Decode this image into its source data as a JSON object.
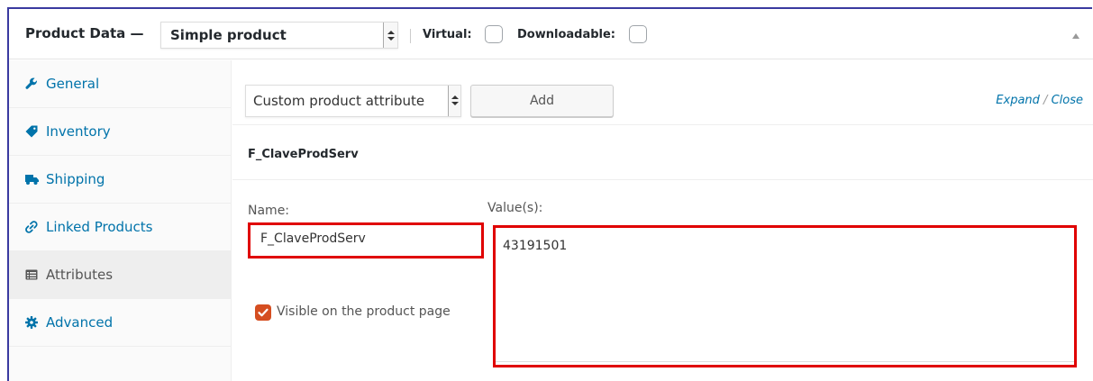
{
  "header": {
    "title": "Product Data —",
    "product_type": "Simple product",
    "virtual_label": "Virtual:",
    "downloadable_label": "Downloadable:"
  },
  "sidebar": {
    "items": [
      {
        "label": "General",
        "icon": "wrench-icon"
      },
      {
        "label": "Inventory",
        "icon": "tag-icon"
      },
      {
        "label": "Shipping",
        "icon": "truck-icon"
      },
      {
        "label": "Linked Products",
        "icon": "link-icon"
      },
      {
        "label": "Attributes",
        "icon": "list-icon",
        "active": true
      },
      {
        "label": "Advanced",
        "icon": "gear-icon"
      }
    ]
  },
  "toolbar": {
    "attribute_select": "Custom product attribute",
    "add_label": "Add",
    "expand_label": "Expand",
    "link_separator": "/",
    "close_label": "Close"
  },
  "attribute": {
    "title": "F_ClaveProdServ",
    "name_label": "Name:",
    "name_value": "F_ClaveProdServ",
    "values_label": "Value(s):",
    "values_value": "43191501",
    "visible_label": "Visible on the product page",
    "visible_checked": true
  },
  "colors": {
    "accent": "#0073aa",
    "highlight": "#e00000",
    "checkbox": "#d54e21"
  }
}
